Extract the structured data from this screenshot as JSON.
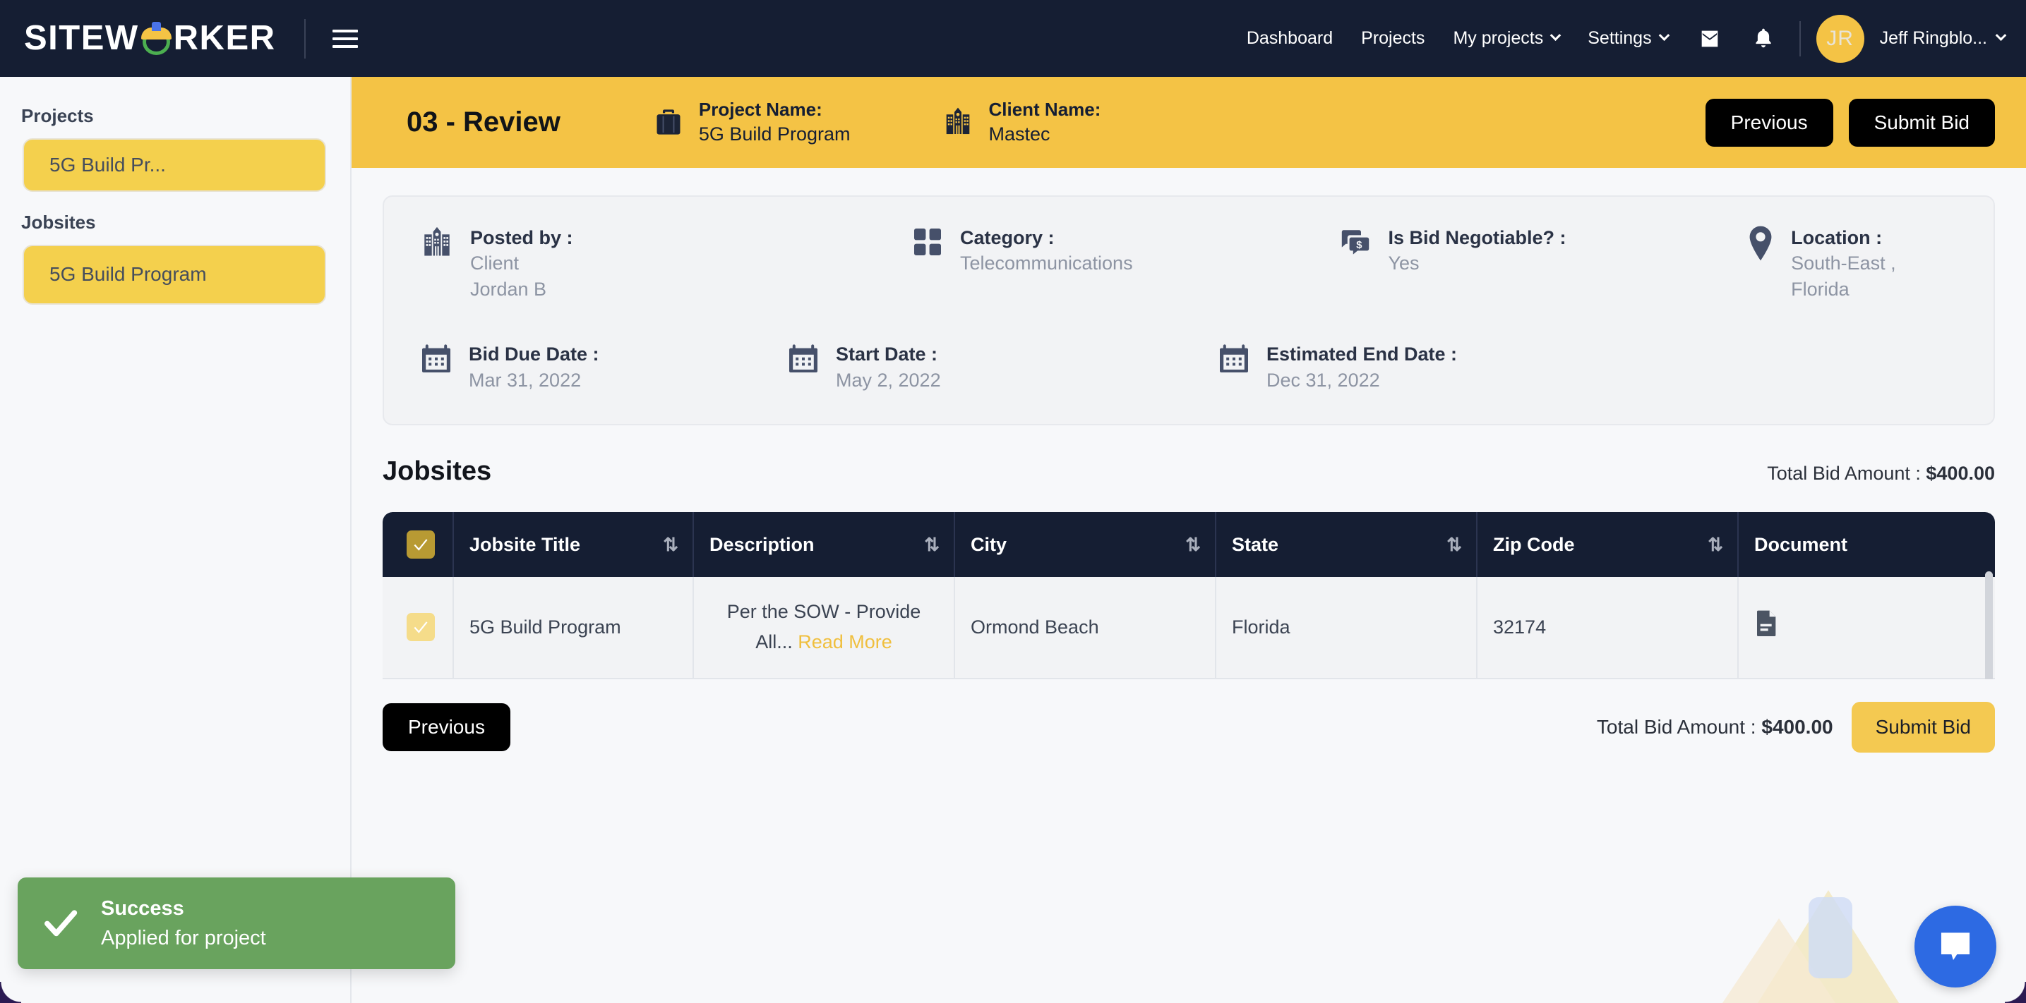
{
  "brand": {
    "name": "SITEWORKER",
    "logo_icon": "worker-helmet-icon",
    "menu_icon": "hamburger-menu-icon"
  },
  "topnav": {
    "links": [
      {
        "label": "Dashboard",
        "has_caret": false
      },
      {
        "label": "Projects",
        "has_caret": false
      },
      {
        "label": "My projects",
        "has_caret": true
      },
      {
        "label": "Settings",
        "has_caret": true
      }
    ],
    "mail_icon": "mail-icon",
    "bell_icon": "notification-bell-icon",
    "avatar_initials": "JR",
    "user_label": "Jeff Ringblo...",
    "user_caret_icon": "chevron-down-icon"
  },
  "sidebar": {
    "projects_heading": "Projects",
    "projects_items": [
      {
        "label": "5G Build Pr..."
      }
    ],
    "jobsites_heading": "Jobsites",
    "jobsites_items": [
      {
        "label": "5G Build Program"
      }
    ]
  },
  "page_header": {
    "step": "03 - Review",
    "project": {
      "icon": "briefcase-icon",
      "label": "Project Name:",
      "value": "5G Build Program"
    },
    "client": {
      "icon": "building-icon",
      "label": "Client Name:",
      "value": "Mastec"
    },
    "previous_label": "Previous",
    "submit_label": "Submit Bid"
  },
  "details": {
    "row1": [
      {
        "icon": "building-icon",
        "label": "Posted by :",
        "value": "Client",
        "value2": "Jordan B"
      },
      {
        "icon": "grid-squares-icon",
        "label": "Category :",
        "value": "Telecommunications"
      },
      {
        "icon": "chat-dollar-icon",
        "label": "Is Bid Negotiable? :",
        "value": "Yes"
      },
      {
        "icon": "map-pin-icon",
        "label": "Location :",
        "value": "South-East , Florida"
      }
    ],
    "row2": [
      {
        "icon": "calendar-icon",
        "label": "Bid Due Date :",
        "value": "Mar 31, 2022"
      },
      {
        "icon": "calendar-icon",
        "label": "Start Date :",
        "value": "May 2, 2022"
      },
      {
        "icon": "calendar-icon",
        "label": "Estimated End Date :",
        "value": "Dec 31, 2022"
      }
    ]
  },
  "jobsites_section": {
    "title": "Jobsites",
    "total_label": "Total Bid Amount :",
    "total_value": "$400.00",
    "columns": [
      {
        "label": "Jobsite Title",
        "sortable": true
      },
      {
        "label": "Description",
        "sortable": true
      },
      {
        "label": "City",
        "sortable": true
      },
      {
        "label": "State",
        "sortable": true
      },
      {
        "label": "Zip Code",
        "sortable": true
      },
      {
        "label": "Document",
        "sortable": false
      }
    ],
    "sort_icon": "sort-arrows-icon",
    "rows": [
      {
        "checked": true,
        "title": "5G Build Program",
        "description": "Per the SOW - Provide All...",
        "read_more": "Read More",
        "city": "Ormond Beach",
        "state": "Florida",
        "zip": "32174",
        "document_icon": "document-file-icon"
      }
    ]
  },
  "footer": {
    "previous_label": "Previous",
    "total_label": "Total Bid Amount :",
    "total_value": "$400.00",
    "submit_label": "Submit Bid"
  },
  "toast": {
    "icon": "check-icon",
    "title": "Success",
    "message": "Applied for project"
  },
  "chat": {
    "icon": "chat-bubble-icon"
  },
  "colors": {
    "navy": "#151e33",
    "yellow": "#f4c345",
    "yellow_pill": "#f4d04d",
    "green_success": "#69a35e",
    "chat_blue": "#2d6ae3",
    "page_bg": "#f7f8fa",
    "card_bg": "#f2f3f5"
  }
}
